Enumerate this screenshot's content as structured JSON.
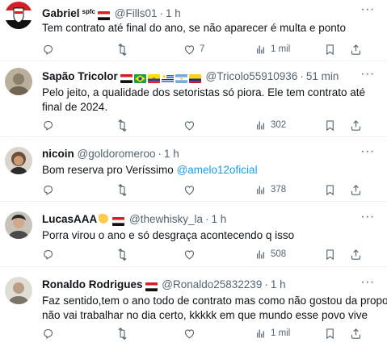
{
  "tweets": [
    {
      "name": "Gabriel",
      "badge": "spfc",
      "handle": "@Fills01",
      "time": "1 h",
      "text": "Tem contrato até final do ano, se não aparecer é multa e ponto",
      "replies": "",
      "retweets": "",
      "likes": "7",
      "views": "1 mil",
      "avatar_color": "#c0392b",
      "flags": [
        "sao-paulo-fc"
      ]
    },
    {
      "name": "Sapão Tricolor",
      "handle": "@Tricolo55910936",
      "time": "51 min",
      "text": "Pelo jeito, a qualidade dos setoristas só piora. Ele tem contrato até final de 2024.",
      "replies": "",
      "retweets": "",
      "likes": "",
      "views": "302",
      "avatar_color": "#8a7f6a",
      "flags": [
        "sao-paulo-fc",
        "brazil",
        "ecuador",
        "uruguay",
        "argentina",
        "colombia"
      ]
    },
    {
      "name": "nicoin",
      "handle": "@goldoromeroo",
      "time": "1 h",
      "text_before": "Bom reserva pro Veríssimo ",
      "mention": "@amelo12oficial",
      "replies": "",
      "retweets": "",
      "likes": "",
      "views": "378",
      "avatar_color": "#6b4f3a",
      "flags": []
    },
    {
      "name": "LucasAAA",
      "handle": "@thewhisky_la",
      "time": "1 h",
      "text": "Porra virou o ano e só desgraça acontecendo q isso",
      "replies": "",
      "retweets": "",
      "likes": "",
      "views": "508",
      "avatar_color": "#7d7468",
      "flags": [
        "sao-paulo-fc"
      ]
    },
    {
      "name": "Ronaldo Rodrigues",
      "handle": "@Ronaldo25832239",
      "time": "1 h",
      "text_line1": "Faz sentido,tem o ano todo de contrato mas como não gostou da proposta",
      "text_line2": "não vai trabalhar no dia certo, kkkkk em que mundo esse povo vive",
      "replies": "",
      "retweets": "",
      "likes": "",
      "views": "1 mil",
      "avatar_color": "#9c9488",
      "flags": [
        "sao-paulo-fc"
      ]
    }
  ],
  "colors": {
    "text": "#0f1419",
    "muted": "#536471",
    "link": "#1d9bf0",
    "divider": "#eff3f4"
  }
}
